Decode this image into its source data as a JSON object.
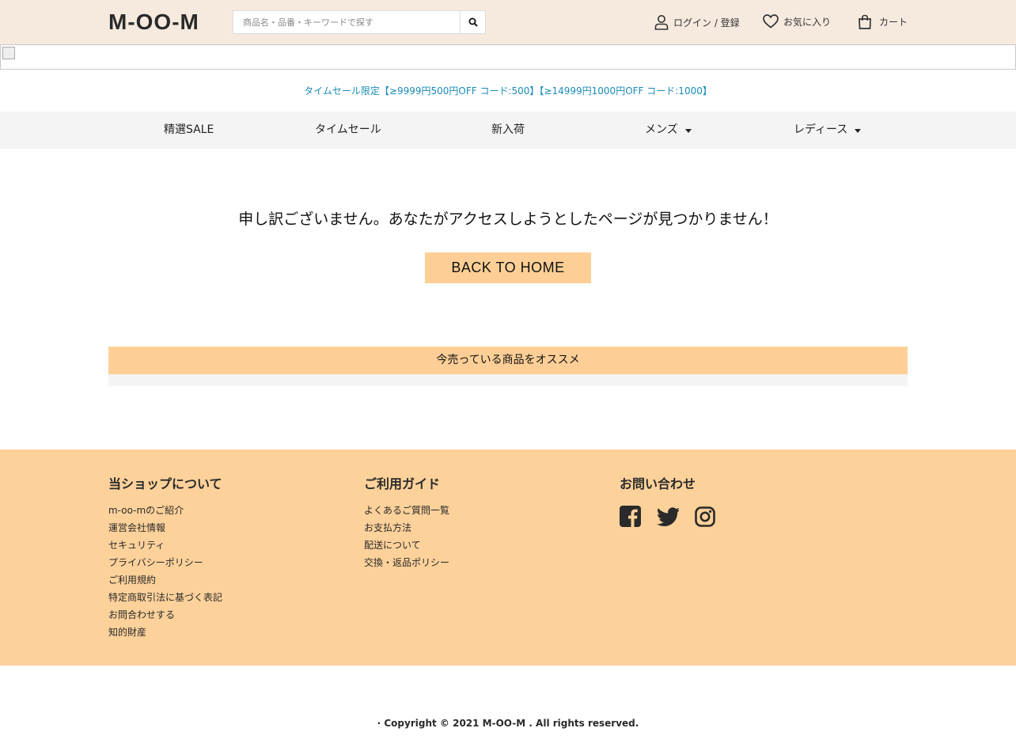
{
  "header": {
    "logo": "M-OO-M",
    "search_placeholder": "商品名・品番・キーワードで探す",
    "login_label": "ログイン / 登録",
    "favorites_label": "お気に入り",
    "cart_label": "カート"
  },
  "promo": {
    "text": "タイムセール限定【≥9999円500円OFF コード:500】【≥14999円1000円OFF コード:1000】",
    "color": "#1a8bb8"
  },
  "nav": {
    "items": [
      {
        "label": "精選SALE"
      },
      {
        "label": "タイムセール"
      },
      {
        "label": "新入荷"
      },
      {
        "label": "メンズ"
      },
      {
        "label": "レディース"
      }
    ]
  },
  "main": {
    "error_message": "申し訳ございません。あなたがアクセスしようとしたページが見つかりません！",
    "home_button": "BACK TO HOME",
    "recommend_title": "今売っている商品をオススメ",
    "accent": "#fdcf96"
  },
  "footer": {
    "about": {
      "title": "当ショップについて",
      "links": [
        "m-oo-mのご紹介",
        "運営会社情報",
        "セキュリティ",
        "プライバシーポリシー",
        "ご利用規約",
        "特定商取引法に基づく表記",
        "お問合わせする",
        "知的財産"
      ]
    },
    "guide": {
      "title": "ご利用ガイド",
      "links": [
        "よくあるご質問一覧",
        "お支払方法",
        "配送について",
        "交換・返品ポリシー"
      ]
    },
    "contact": {
      "title": "お問い合わせ",
      "icons": [
        "facebook-icon",
        "twitter-icon",
        "instagram-icon"
      ]
    },
    "background": "#fdd19a"
  },
  "copyright": "· Copyright © 2021 M-OO-M . All rights reserved."
}
